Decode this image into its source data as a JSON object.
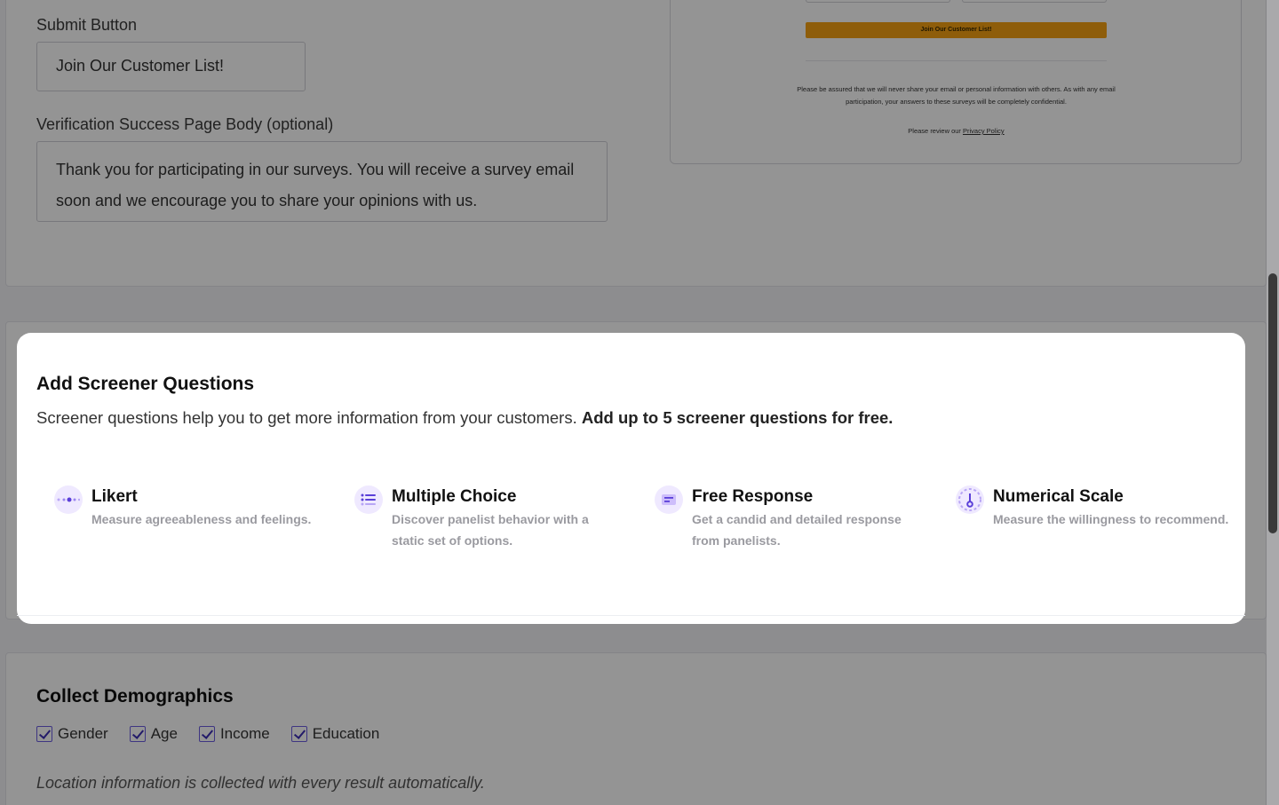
{
  "form": {
    "submit_label": "Submit Button",
    "submit_value": "Join Our Customer List!",
    "body_label": "Verification Success Page Body (optional)",
    "body_value": "Thank you for participating in our surveys. You will receive a survey email soon and we encourage you to share your opinions with us."
  },
  "preview": {
    "button_text": "Join Our Customer List!",
    "privacy_text": "Please be assured that we will never share your email or personal information with others. As with any email participation, your answers to these surveys will be completely confidential.",
    "policy_prefix": "Please review our ",
    "policy_link": "Privacy Policy",
    "button_color": "#f5a012"
  },
  "screener": {
    "title": "Add Screener Questions",
    "description": "Screener questions help you to get more information from your customers. ",
    "description_bold": "Add up to 5 screener questions for free.",
    "types": [
      {
        "title": "Likert",
        "desc": "Measure agreeableness and feelings.",
        "icon": "likert-dots-icon"
      },
      {
        "title": "Multiple Choice",
        "desc": "Discover panelist behavior with a static set of options.",
        "icon": "list-icon"
      },
      {
        "title": "Free Response",
        "desc": "Get a candid and detailed response from panelists.",
        "icon": "text-lines-icon"
      },
      {
        "title": "Numerical Scale",
        "desc": "Measure the willingness to recommend.",
        "icon": "gauge-icon"
      }
    ],
    "accent": "#6b4de6"
  },
  "demographics": {
    "title": "Collect Demographics",
    "options": [
      {
        "label": "Gender",
        "checked": true
      },
      {
        "label": "Age",
        "checked": true
      },
      {
        "label": "Income",
        "checked": true
      },
      {
        "label": "Education",
        "checked": true
      }
    ],
    "note": "Location information is collected with every result automatically."
  }
}
